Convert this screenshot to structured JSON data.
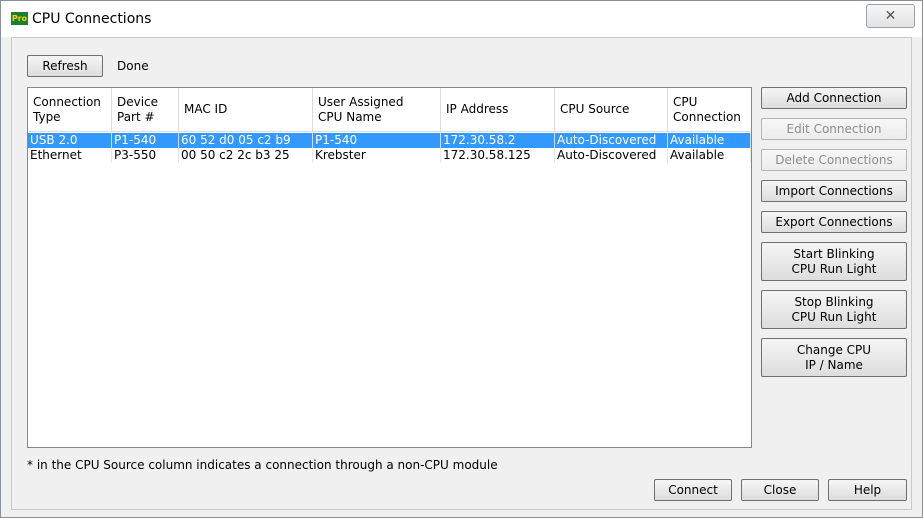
{
  "window": {
    "title": "CPU Connections",
    "app_icon_text": "Pro",
    "close_glyph": "✕"
  },
  "toolbar": {
    "refresh_label": "Refresh",
    "status_text": "Done"
  },
  "table": {
    "columns": [
      {
        "line1": "Connection",
        "line2": "Type"
      },
      {
        "line1": "Device",
        "line2": "Part #"
      },
      {
        "line1": "MAC ID",
        "line2": ""
      },
      {
        "line1": "User Assigned",
        "line2": "CPU Name"
      },
      {
        "line1": "IP Address",
        "line2": ""
      },
      {
        "line1": "CPU Source",
        "line2": ""
      },
      {
        "line1": "CPU",
        "line2": "Connection"
      }
    ],
    "rows": [
      {
        "selected": true,
        "cells": [
          "USB 2.0",
          "P1-540",
          "60 52 d0 05 c2 b9",
          "P1-540",
          "172.30.58.2",
          "Auto-Discovered",
          "Available"
        ]
      },
      {
        "selected": false,
        "cells": [
          "Ethernet",
          "P3-550",
          "00 50 c2 2c b3 25",
          "Krebster",
          "172.30.58.125",
          "Auto-Discovered",
          "Available"
        ]
      }
    ],
    "selection_color": "#3399ff"
  },
  "side_buttons": {
    "add_connection": "Add Connection",
    "edit_connection": "Edit Connection",
    "delete_connections": "Delete Connections",
    "import_connections": "Import Connections",
    "export_connections": "Export Connections",
    "start_blinking_1": "Start Blinking",
    "start_blinking_2": "CPU Run Light",
    "stop_blinking_1": "Stop Blinking",
    "stop_blinking_2": "CPU Run Light",
    "change_cpu_1": "Change CPU",
    "change_cpu_2": "IP / Name"
  },
  "footer": {
    "note": "* in the CPU Source column indicates a connection through a non-CPU module",
    "connect_label": "Connect",
    "close_label": "Close",
    "help_label": "Help"
  }
}
